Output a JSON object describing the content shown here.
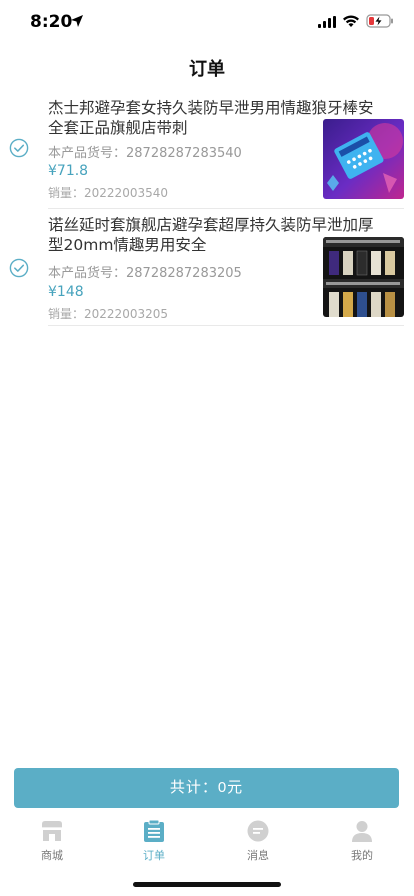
{
  "status_bar": {
    "time": "8:20"
  },
  "nav": {
    "title": "订单"
  },
  "orders": [
    {
      "title": "杰士邦避孕套女持久装防早泄男用情趣狼牙棒安全套正品旗舰店带刺",
      "sku_label": "本产品货号：",
      "sku": "28728287283540",
      "price": "¥71.8",
      "sales_label": "销量：",
      "sales": "20222003540",
      "checked": true
    },
    {
      "title": "诺丝延时套旗舰店避孕套超厚持久装防早泄加厚型20mm情趣男用安全",
      "sku_label": "本产品货号：",
      "sku": "28728287283205",
      "price": "¥148",
      "sales_label": "销量：",
      "sales": "20222003205",
      "checked": true
    }
  ],
  "total": {
    "label": "共计：0元"
  },
  "tabs": [
    {
      "label": "商城",
      "icon": "store-icon",
      "active": false
    },
    {
      "label": "订单",
      "icon": "order-list-icon",
      "active": true
    },
    {
      "label": "消息",
      "icon": "message-icon",
      "active": false
    },
    {
      "label": "我的",
      "icon": "user-icon",
      "active": false
    }
  ],
  "colors": {
    "accent": "#5baec6",
    "price": "#47a3bd",
    "inactive_icon": "#d0d0d0"
  }
}
